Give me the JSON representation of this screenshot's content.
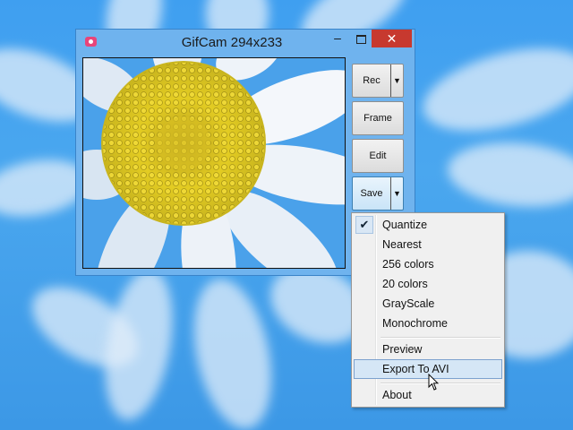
{
  "window": {
    "title": "GifCam 294x233",
    "minimize_glyph": "–",
    "close_glyph": "✕",
    "app_icon": "camera-icon"
  },
  "buttons": {
    "rec": "Rec",
    "frame": "Frame",
    "edit": "Edit",
    "save": "Save",
    "dropdown_glyph": "▼"
  },
  "save_menu": {
    "items": [
      {
        "label": "Quantize",
        "checked": true
      },
      {
        "label": "Nearest",
        "checked": false
      },
      {
        "label": "256 colors",
        "checked": false
      },
      {
        "label": "20 colors",
        "checked": false
      },
      {
        "label": "GrayScale",
        "checked": false
      },
      {
        "label": "Monochrome",
        "checked": false
      },
      {
        "label": "Preview",
        "checked": false
      },
      {
        "label": "Export To AVI",
        "checked": false,
        "hovered": true
      },
      {
        "label": "About",
        "checked": false
      }
    ],
    "check_glyph": "✔"
  },
  "colors": {
    "desktop": "#3f9ff0",
    "close_button": "#c7392f",
    "window_frame": "#6fb3ee",
    "menu_highlight": "#d5e6f6"
  }
}
